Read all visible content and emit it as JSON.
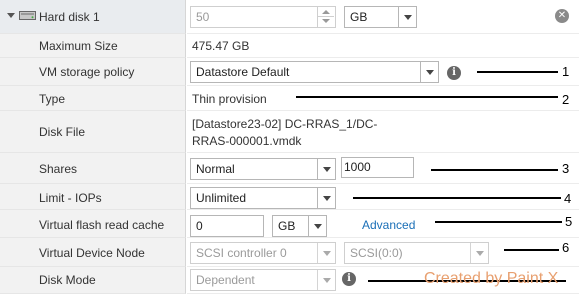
{
  "hard_disk": {
    "title": "Hard disk 1",
    "size_value": "50",
    "size_unit": "GB"
  },
  "rows": {
    "max_size": {
      "label": "Maximum Size",
      "value": "475.47 GB"
    },
    "storage_policy": {
      "label": "VM storage policy",
      "value": "Datastore Default"
    },
    "type": {
      "label": "Type",
      "value": "Thin provision"
    },
    "disk_file": {
      "label": "Disk File",
      "line1": "[Datastore23-02] DC-RRAS_1/DC-",
      "line2": "RRAS-000001.vmdk"
    },
    "shares": {
      "label": "Shares",
      "value": "Normal",
      "number": "1000"
    },
    "limit_iops": {
      "label": "Limit - IOPs",
      "value": "Unlimited"
    },
    "flash_cache": {
      "label": "Virtual flash read cache",
      "value": "0",
      "unit": "GB",
      "advanced": "Advanced"
    },
    "device_node": {
      "label": "Virtual Device Node",
      "controller": "SCSI controller 0",
      "node": "SCSI(0:0)"
    },
    "disk_mode": {
      "label": "Disk Mode",
      "value": "Dependent"
    }
  },
  "annotations": [
    "1",
    "2",
    "3",
    "4",
    "5",
    "6"
  ],
  "watermark": "Created by Paint X",
  "icons": {
    "expand": "triangle-down-icon",
    "disk": "hard-disk-icon",
    "info": "info-icon",
    "remove": "remove-icon"
  }
}
